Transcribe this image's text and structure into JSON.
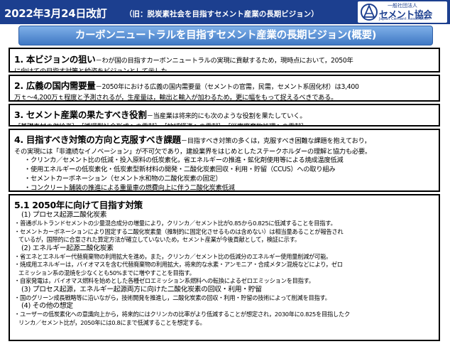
{
  "header": {
    "date": "2022年3月24日改訂",
    "old_title": "（旧：脱炭素社会を目指すセメント産業の長期ビジョン）",
    "logo": {
      "org": "一般社団法人",
      "name": "セメント協会",
      "en": "Japan Cement Association",
      "icon": "jca-logo-icon"
    }
  },
  "main_title": "カーボンニュートラルを目指すセメント産業の長期ビジョン(概要)",
  "sections": {
    "s1": {
      "heading": "1.  本ビジョンの狙い",
      "line1": "－わが国の目指すカーボンニュートラルの実現に貢献するため，現時点において，2050年",
      "line2": "に向けての目指す対策と絵姿をビジョンとして示した。"
    },
    "s2": {
      "heading": "2.  広義の国内需要量",
      "line1": "－2050年における広義の国内需要量（セメントの官需，民需，セメント系固化材）は3,400",
      "line2": "万ｔ～4,200万ｔ程度と予測されるが，生産量は，輸出と輸入が加わるため，更に幅をもって捉えるべきである。"
    },
    "s3": {
      "heading": "3. セメント産業の果たすべき役割",
      "line1": "－当産業は将来的にも次のような役割を果たしていく。",
      "line2": "［基礎素材の供給者］，［循環型社会形成への貢献］，［地域経済への貢献］，［災害廃棄物処理への貢献］"
    },
    "s4": {
      "heading": "4. 目指すべき対策の方向と克服すべき課題",
      "line1": "－目指すべき対策の多くは，克服すべき困難な課題を抱えており，",
      "line2": "その実現には「非連続なイノベーション」が不可欠であり，建設業界をはじめとしたステークホルダーの理解と協力も必要。",
      "bullets": [
        "・クリンカ／セメント比の低減・投入原料の低炭素化，省エネルギーの推進・鉱化剤使用等による焼成温度低減",
        "・使用エネルギーの低炭素化・低炭素型新材料の開発・二酸化炭素回収・利用・貯留（CCUS）への取り組み",
        "・セメントカーボネーション（セメント水和物の二酸化炭素の固定）",
        "・コンクリート舗装の推進による重量車の燃費向上に伴う二酸化炭素低減"
      ]
    },
    "s5": {
      "heading": "5.1 2050年に向けて目指す対策",
      "p1": {
        "title": "(1) プロセス起源二酸化炭素",
        "items": [
          "・普通ポルトランドセメントの少量混合成分の増量により，クリンカ／セメント比が0.85から0.825に低減することを目指す。",
          "・セメントカーボネーションにより固定する二酸化炭素量（推制的に固定化させるものは含めない）は相当量あることが報告され",
          "  ているが，国際的に合意された算定方法が確立していないため，セメント産業が今後貢献として，検証に示す。"
        ]
      },
      "p2": {
        "title": "(2) エネルギー起源二酸化炭素",
        "items": [
          "・省エネとエネルギー代替廃棄物の利用拡大を進め，また，クリンカ／セメント比の低減分のエネルギー使用量削減が可能。",
          "・焼成用エネルギーは，バイオマスを含む代替廃棄物の利用拡大，将来的な水素・アンモニア・合成メタン混焼などにより，ゼロ",
          "  エミッション系の混焼を少なくとも50%までに増やすことを目指す。",
          "・自家発電は，バイオマス燃料を始めとした各種ゼロエミッション系燃料への転換によるゼロエミッションを目指す。"
        ]
      },
      "p3": {
        "title": "(3) プロセス起源，エネルギー起源両方に向けた二酸化炭素の回収・利用・貯留",
        "items": [
          "・国のグリーン成長戦略等に沿いながら，技術開発を推進し，二酸化炭素の回収・利用・貯留の技術によって削減を目指す。"
        ]
      },
      "p4": {
        "title": "(4) その他の想定",
        "items": [
          "・ユーザーの低炭素化への意識向上から，将来的にはクリンカの比率がより低減することが想定され，2030年に0.825を目指したク",
          "  リンカ／セメント比が，2050年には0.8にまで低減することを想定する。"
        ]
      }
    }
  },
  "colors": {
    "header_bg": "#1c3f8f",
    "title_bar": "#3f78c4",
    "border": "#000000"
  }
}
